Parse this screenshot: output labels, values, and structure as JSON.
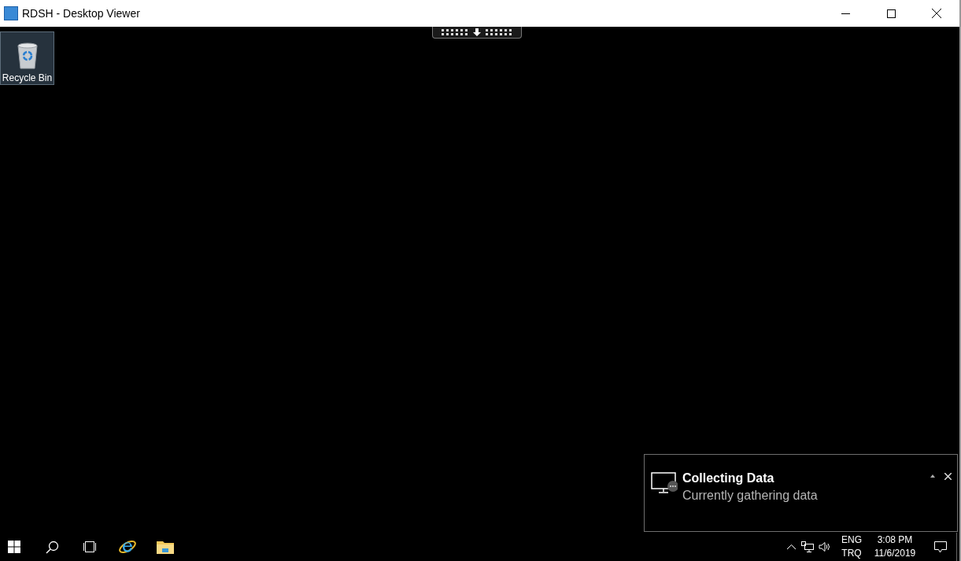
{
  "window": {
    "title": "RDSH - Desktop Viewer"
  },
  "desktop_icons": [
    {
      "label": "Recycle Bin",
      "selected": true
    }
  ],
  "notification": {
    "title": "Collecting Data",
    "message": "Currently gathering data"
  },
  "tray": {
    "language": "ENG",
    "layout": "TRQ",
    "time": "3:08 PM",
    "date": "11/6/2019"
  }
}
